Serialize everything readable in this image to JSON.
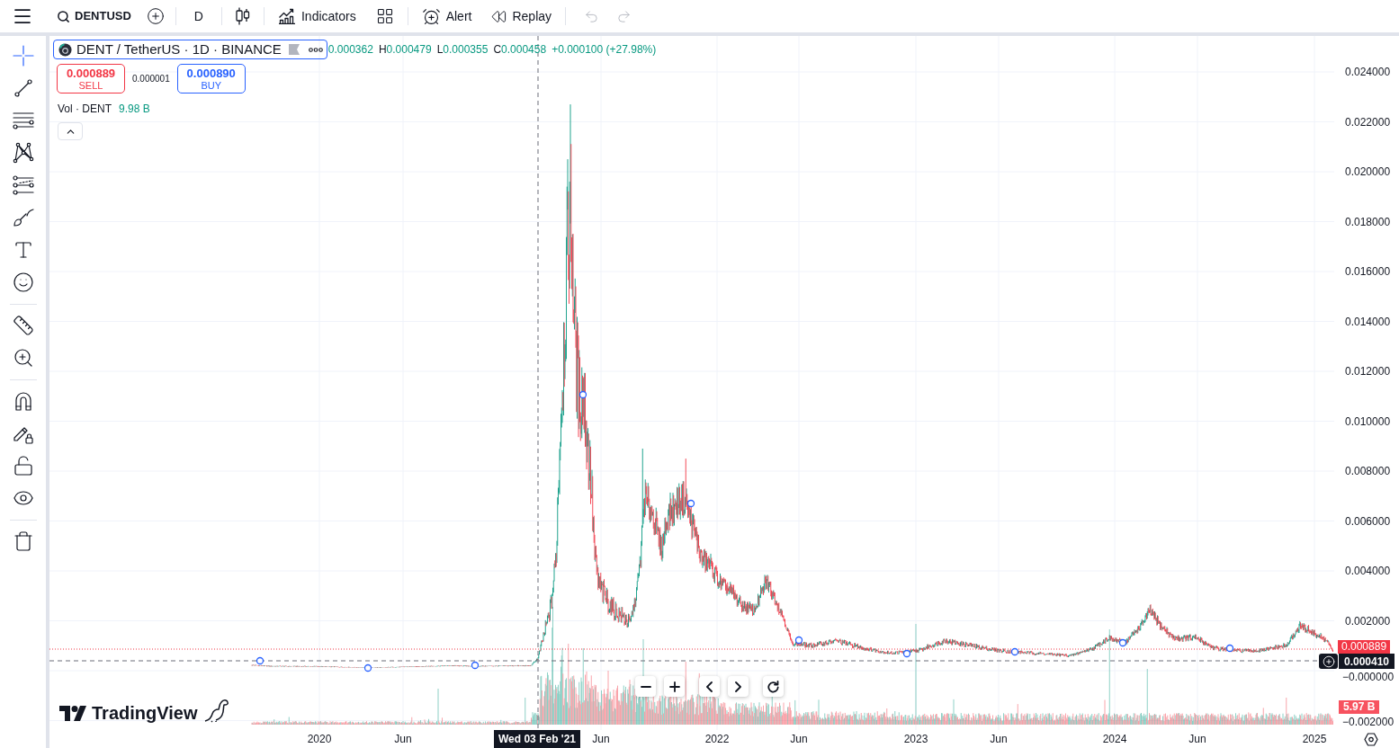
{
  "toolbar": {
    "symbol": "DENTUSD",
    "interval": "D",
    "items": [
      {
        "kind": "chart_type"
      },
      {
        "kind": "indicators",
        "label": "Indicators"
      },
      {
        "kind": "layouts"
      },
      {
        "kind": "alert",
        "label": "Alert"
      },
      {
        "kind": "replay",
        "label": "Replay"
      }
    ],
    "history": [
      {
        "kind": "undo",
        "disabled": true
      },
      {
        "kind": "redo",
        "disabled": true
      }
    ]
  },
  "drawing_tools": [
    [
      {
        "kind": "crosshair",
        "selected": true
      },
      {
        "kind": "trend_line",
        "selected": false
      },
      {
        "kind": "fib",
        "selected": false
      },
      {
        "kind": "pattern",
        "selected": false
      },
      {
        "kind": "projection",
        "selected": false
      },
      {
        "kind": "brush",
        "selected": false
      },
      {
        "kind": "text",
        "selected": false
      },
      {
        "kind": "emoji",
        "selected": false
      }
    ],
    [
      {
        "kind": "ruler",
        "selected": false
      },
      {
        "kind": "zoom",
        "selected": false
      }
    ],
    [
      {
        "kind": "magnet",
        "selected": false
      },
      {
        "kind": "lock_drawings",
        "selected": false
      },
      {
        "kind": "unlock",
        "selected": false
      },
      {
        "kind": "hide",
        "selected": false
      }
    ],
    [
      {
        "kind": "trash",
        "selected": false
      }
    ]
  ],
  "legend": {
    "title": "DENT / TetherUS · 1D · BINANCE",
    "ohlc": [
      {
        "value": "0.000362"
      },
      {
        "label": "H",
        "value": "0.000479"
      },
      {
        "label": "L",
        "value": "0.000355"
      },
      {
        "label": "C",
        "value": "0.000458"
      }
    ],
    "change": "+0.000100 (+27.98%)",
    "sell": {
      "price": "0.000889",
      "label": "SELL"
    },
    "spread": "0.000001",
    "buy": {
      "price": "0.000890",
      "label": "BUY"
    },
    "volume": {
      "label": "Vol · DENT",
      "value": "9.98 B"
    }
  },
  "price_scale": {
    "ticks": [
      "0.024000",
      "0.022000",
      "0.020000",
      "0.018000",
      "0.016000",
      "0.014000",
      "0.012000",
      "0.010000",
      "0.008000",
      "0.006000",
      "0.004000",
      "0.002000"
    ],
    "current_price": "0.000889",
    "crosshair_price": "0.000410",
    "zero_tick": "−0.000000",
    "volume_value": "5.97 B",
    "bottom_tick": "−0.002000"
  },
  "time_scale": {
    "labels": [
      "2020",
      "Jun",
      "Jun",
      "2022",
      "Jun",
      "2023",
      "Jun",
      "2024",
      "Jun",
      "2025"
    ],
    "crosshair_date": "Wed 03 Feb '21"
  },
  "nav_buttons": [
    [
      {
        "kind": "zoom_out"
      },
      {
        "kind": "zoom_in"
      }
    ],
    [
      {
        "kind": "scroll_left"
      },
      {
        "kind": "scroll_right"
      }
    ],
    [
      {
        "kind": "reset"
      }
    ]
  ],
  "branding": {
    "name": "TradingView"
  }
}
